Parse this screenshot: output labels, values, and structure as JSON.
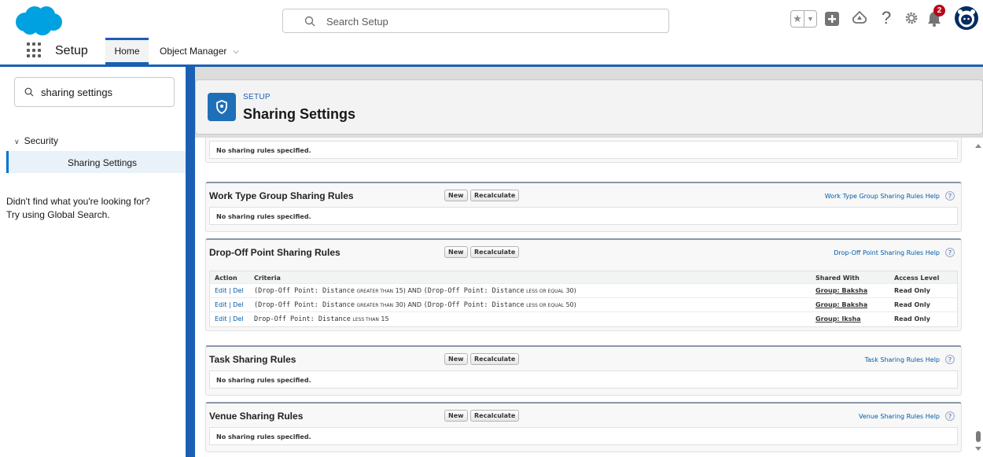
{
  "header": {
    "search_placeholder": "Search Setup",
    "notification_count": "2",
    "colors": {
      "brand": "#00a1e0",
      "accent": "#1b5fb4",
      "badge": "#ba0517"
    }
  },
  "nav": {
    "app_name": "Setup",
    "tabs": [
      {
        "label": "Home",
        "active": true
      },
      {
        "label": "Object Manager",
        "active": false
      }
    ]
  },
  "sidebar": {
    "quick_find_value": "sharing settings",
    "section_label": "Security",
    "selected_item": "Sharing Settings",
    "help_line1": "Didn't find what you're looking for?",
    "help_line2": "Try using Global Search."
  },
  "page": {
    "eyebrow": "SETUP",
    "title": "Sharing Settings"
  },
  "content": {
    "top_no_rules": "No sharing rules specified.",
    "button_new": "New",
    "button_recalc": "Recalculate",
    "sections": [
      {
        "title": "Work Type Group Sharing Rules",
        "help": "Work Type Group Sharing Rules Help",
        "empty": "No sharing rules specified."
      },
      {
        "title": "Drop-Off Point Sharing Rules",
        "help": "Drop-Off Point Sharing Rules Help",
        "columns": [
          "Action",
          "Criteria",
          "Shared With",
          "Access Level"
        ],
        "rows": [
          {
            "edit": "Edit",
            "sep": "|",
            "del": "Del",
            "crit_a": "(Drop-Off Point: Distance",
            "op_a": "GREATER THAN",
            "val_a": "15) AND",
            "crit_b": "(Drop-Off Point: Distance",
            "op_b": "LESS OR EQUAL",
            "val_b": "30)",
            "shared": "Group: Baksha",
            "access": "Read Only"
          },
          {
            "edit": "Edit",
            "sep": "|",
            "del": "Del",
            "crit_a": "(Drop-Off Point: Distance",
            "op_a": "GREATER THAN",
            "val_a": "30) AND",
            "crit_b": "(Drop-Off Point: Distance",
            "op_b": "LESS OR EQUAL",
            "val_b": "50)",
            "shared": "Group: Baksha",
            "access": "Read Only"
          },
          {
            "edit": "Edit",
            "sep": "|",
            "del": "Del",
            "crit_a": "Drop-Off Point: Distance",
            "op_a": "LESS THAN",
            "val_a": "15",
            "shared": "Group: Iksha",
            "access": "Read Only"
          }
        ]
      },
      {
        "title": "Task Sharing Rules",
        "help": "Task Sharing Rules Help",
        "empty": "No sharing rules specified."
      },
      {
        "title": "Venue Sharing Rules",
        "help": "Venue Sharing Rules Help",
        "empty": "No sharing rules specified."
      }
    ]
  }
}
